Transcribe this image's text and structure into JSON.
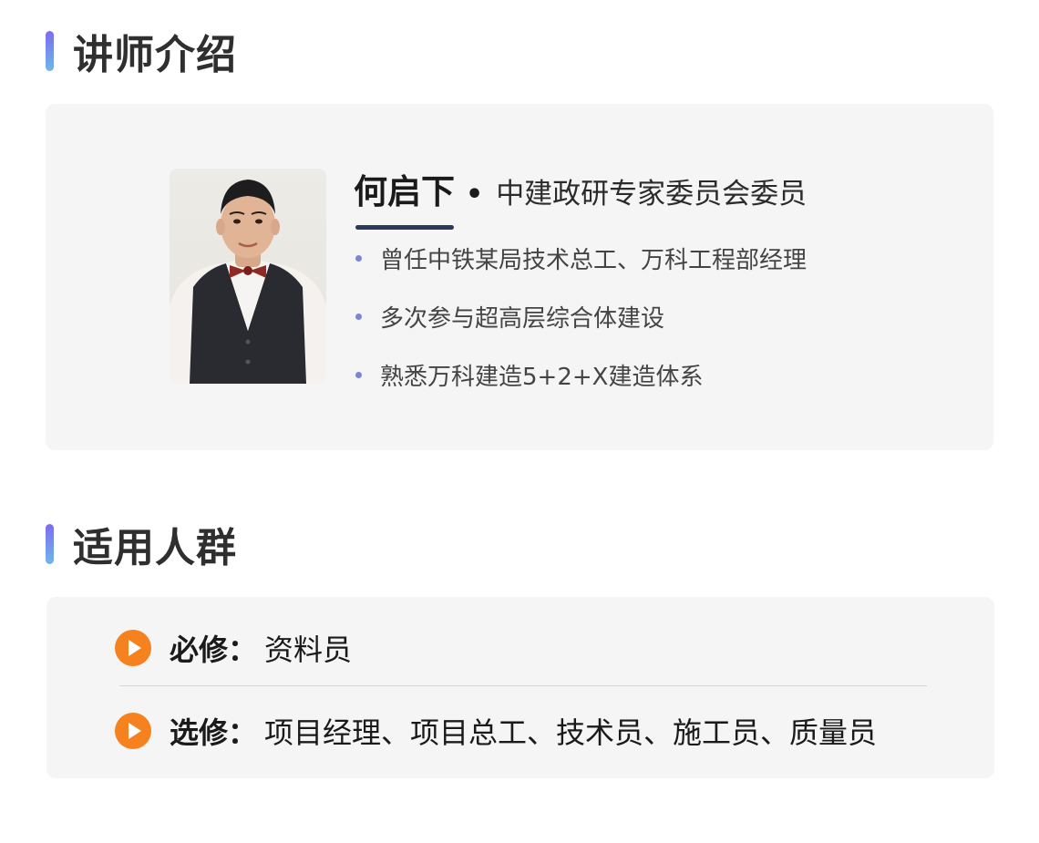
{
  "teacher_section": {
    "title": "讲师介绍",
    "name": "何启下",
    "separator": "•",
    "position": "中建政研专家委员会委员",
    "bullets": [
      "曾任中铁某局技术总工、万科工程部经理",
      "多次参与超高层综合体建设",
      "熟悉万科建造5+2+X建造体系"
    ]
  },
  "audience_section": {
    "title": "适用人群",
    "required": {
      "label": "必修：",
      "value": "资料员"
    },
    "elective": {
      "label": "选修：",
      "value": "项目经理、项目总工、技术员、施工员、质量员"
    }
  },
  "colors": {
    "accent_bar_top": "#7c6cf0",
    "accent_bar_bottom": "#6fb7e9",
    "bullet_dot": "#7d83d6",
    "play_icon": "#f5821f",
    "card_bg": "#f5f5f5",
    "name_underline": "#2c3a5c"
  }
}
